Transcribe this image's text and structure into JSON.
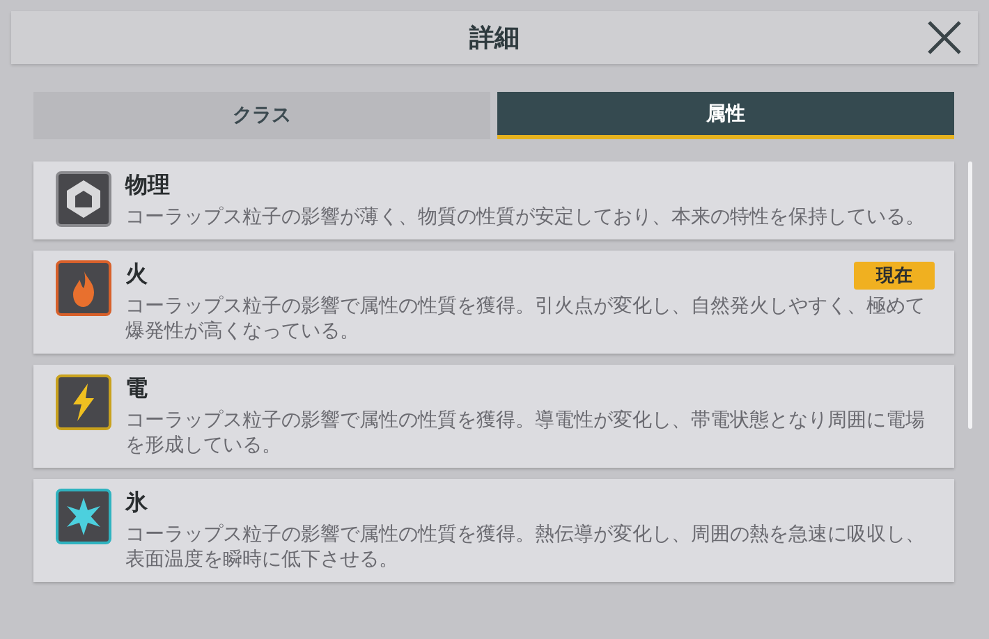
{
  "dialog": {
    "title": "詳細"
  },
  "tabs": [
    {
      "label": "クラス",
      "selected": false
    },
    {
      "label": "属性",
      "selected": true
    }
  ],
  "attributes": [
    {
      "kind": "physical",
      "color": "#8a8a8e",
      "name": "物理",
      "description": "コーラップス粒子の影響が薄く、物質の性質が安定しており、本来の特性を保持している。"
    },
    {
      "kind": "fire",
      "color": "#d8602a",
      "name": "火",
      "badge": "現在",
      "description": "コーラップス粒子の影響で属性の性質を獲得。引火点が変化し、自然発火しやすく、極めて爆発性が高くなっている。"
    },
    {
      "kind": "electric",
      "color": "#c9a21e",
      "name": "電",
      "description": "コーラップス粒子の影響で属性の性質を獲得。導電性が変化し、帯電状態となり周囲に電場を形成している。"
    },
    {
      "kind": "ice",
      "color": "#2fb3c0",
      "name": "氷",
      "description": "コーラップス粒子の影響で属性の性質を獲得。熱伝導が変化し、周囲の熱を急速に吸収し、表面温度を瞬時に低下させる。"
    }
  ]
}
